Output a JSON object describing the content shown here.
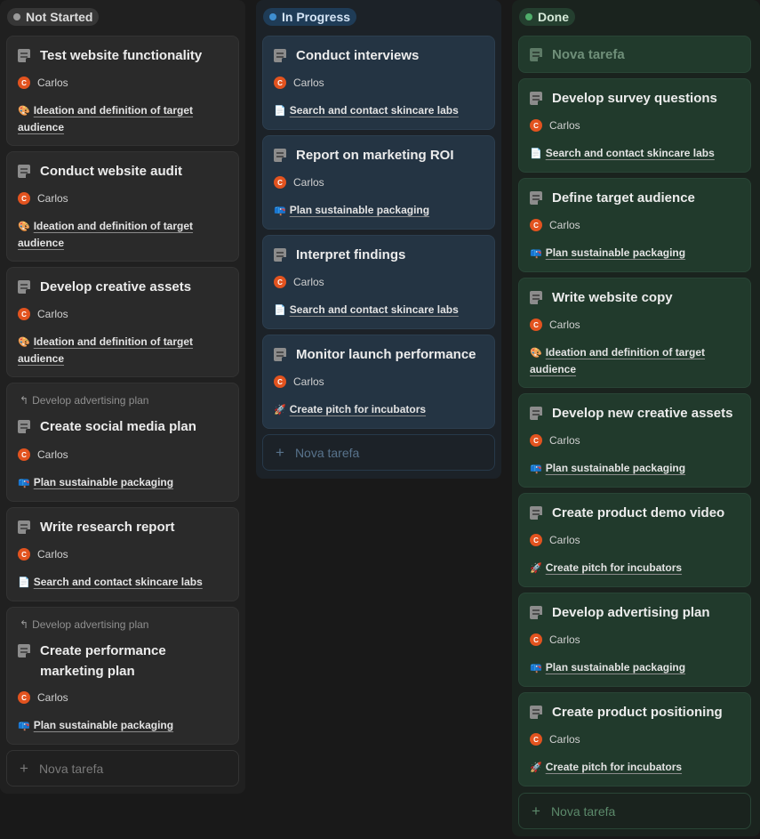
{
  "columns": {
    "not_started": {
      "label": "Not Started",
      "cards": [
        {
          "title": "Test website functionality",
          "assignee": "Carlos",
          "avatar": "C",
          "relation_icon": "🎨",
          "relation": "Ideation and definition of target audience"
        },
        {
          "title": "Conduct website audit",
          "assignee": "Carlos",
          "avatar": "C",
          "relation_icon": "🎨",
          "relation": "Ideation and definition of target audience"
        },
        {
          "title": "Develop creative assets",
          "assignee": "Carlos",
          "avatar": "C",
          "relation_icon": "🎨",
          "relation": "Ideation and definition of target audience"
        },
        {
          "parent": "Develop advertising plan",
          "title": "Create social media plan",
          "assignee": "Carlos",
          "avatar": "C",
          "relation_icon": "📪",
          "relation": "Plan sustainable packaging"
        },
        {
          "title": "Write research report",
          "assignee": "Carlos",
          "avatar": "C",
          "relation_icon": "📄",
          "relation": "Search and contact skincare labs"
        },
        {
          "parent": "Develop advertising plan",
          "title": "Create performance marketing plan",
          "assignee": "Carlos",
          "avatar": "C",
          "relation_icon": "📪",
          "relation": "Plan sustainable packaging"
        }
      ],
      "new_task": "Nova tarefa"
    },
    "in_progress": {
      "label": "In Progress",
      "cards": [
        {
          "title": "Conduct interviews",
          "assignee": "Carlos",
          "avatar": "C",
          "relation_icon": "📄",
          "relation": "Search and contact skincare labs"
        },
        {
          "title": "Report on marketing ROI",
          "assignee": "Carlos",
          "avatar": "C",
          "relation_icon": "📪",
          "relation": "Plan sustainable packaging"
        },
        {
          "title": "Interpret findings",
          "assignee": "Carlos",
          "avatar": "C",
          "relation_icon": "📄",
          "relation": "Search and contact skincare labs"
        },
        {
          "title": "Monitor launch performance",
          "assignee": "Carlos",
          "avatar": "C",
          "relation_icon": "🚀",
          "relation": "Create pitch for incubators"
        }
      ],
      "new_task": "Nova tarefa"
    },
    "done": {
      "label": "Done",
      "ghost_card": "Nova tarefa",
      "cards": [
        {
          "title": "Develop survey questions",
          "assignee": "Carlos",
          "avatar": "C",
          "relation_icon": "📄",
          "relation": "Search and contact skincare labs"
        },
        {
          "title": "Define target audience",
          "assignee": "Carlos",
          "avatar": "C",
          "relation_icon": "📪",
          "relation": "Plan sustainable packaging"
        },
        {
          "title": "Write website copy",
          "assignee": "Carlos",
          "avatar": "C",
          "relation_icon": "🎨",
          "relation": "Ideation and definition of target audience"
        },
        {
          "title": "Develop new creative assets",
          "assignee": "Carlos",
          "avatar": "C",
          "relation_icon": "📪",
          "relation": "Plan sustainable packaging"
        },
        {
          "title": "Create product demo video",
          "assignee": "Carlos",
          "avatar": "C",
          "relation_icon": "🚀",
          "relation": "Create pitch for incubators"
        },
        {
          "title": "Develop advertising plan",
          "assignee": "Carlos",
          "avatar": "C",
          "relation_icon": "📪",
          "relation": "Plan sustainable packaging"
        },
        {
          "title": "Create product positioning",
          "assignee": "Carlos",
          "avatar": "C",
          "relation_icon": "🚀",
          "relation": "Create pitch for incubators"
        }
      ],
      "new_task": "Nova tarefa"
    }
  }
}
